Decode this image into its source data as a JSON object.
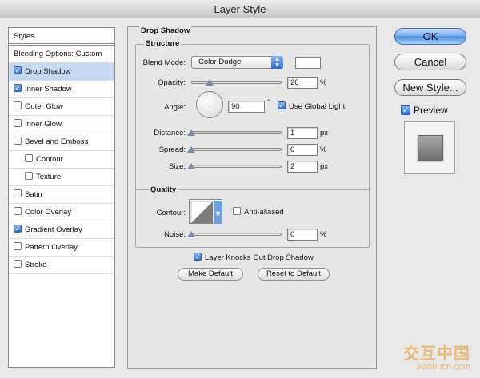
{
  "window": {
    "title": "Layer Style"
  },
  "sidebar": {
    "items": [
      {
        "label": "Styles",
        "checkbox": false,
        "checked": false,
        "indent": 0,
        "selected": false
      },
      {
        "label": "Blending Options: Custom",
        "checkbox": false,
        "checked": false,
        "indent": 0,
        "selected": false
      },
      {
        "label": "Drop Shadow",
        "checkbox": true,
        "checked": true,
        "indent": 0,
        "selected": true
      },
      {
        "label": "Inner Shadow",
        "checkbox": true,
        "checked": true,
        "indent": 0,
        "selected": false
      },
      {
        "label": "Outer Glow",
        "checkbox": true,
        "checked": false,
        "indent": 0,
        "selected": false
      },
      {
        "label": "Inner Glow",
        "checkbox": true,
        "checked": false,
        "indent": 0,
        "selected": false
      },
      {
        "label": "Bevel and Emboss",
        "checkbox": true,
        "checked": false,
        "indent": 0,
        "selected": false
      },
      {
        "label": "Contour",
        "checkbox": true,
        "checked": false,
        "indent": 1,
        "selected": false
      },
      {
        "label": "Texture",
        "checkbox": true,
        "checked": false,
        "indent": 1,
        "selected": false
      },
      {
        "label": "Satin",
        "checkbox": true,
        "checked": false,
        "indent": 0,
        "selected": false
      },
      {
        "label": "Color Overlay",
        "checkbox": true,
        "checked": false,
        "indent": 0,
        "selected": false
      },
      {
        "label": "Gradient Overlay",
        "checkbox": true,
        "checked": true,
        "indent": 0,
        "selected": false
      },
      {
        "label": "Pattern Overlay",
        "checkbox": true,
        "checked": false,
        "indent": 0,
        "selected": false
      },
      {
        "label": "Stroke",
        "checkbox": true,
        "checked": false,
        "indent": 0,
        "selected": false
      }
    ]
  },
  "drop_shadow": {
    "title": "Drop Shadow",
    "structure": {
      "title": "Structure",
      "blend_mode_label": "Blend Mode:",
      "blend_mode_value": "Color Dodge",
      "opacity_label": "Opacity:",
      "opacity_value": "20",
      "opacity_fraction": 0.2,
      "opacity_unit": "%",
      "angle_label": "Angle:",
      "angle_value": "90",
      "angle_unit": "°",
      "use_global_light_label": "Use Global Light",
      "use_global_light_checked": true,
      "distance_label": "Distance:",
      "distance_value": "1",
      "distance_fraction": 0.0,
      "distance_unit": "px",
      "spread_label": "Spread:",
      "spread_value": "0",
      "spread_fraction": 0.0,
      "spread_unit": "%",
      "size_label": "Size:",
      "size_value": "2",
      "size_fraction": 0.0,
      "size_unit": "px"
    },
    "quality": {
      "title": "Quality",
      "contour_label": "Contour:",
      "anti_aliased_label": "Anti-aliased",
      "anti_aliased_checked": false,
      "noise_label": "Noise:",
      "noise_value": "0",
      "noise_fraction": 0.0,
      "noise_unit": "%"
    },
    "knockout_label": "Layer Knocks Out Drop Shadow",
    "knockout_checked": true,
    "make_default_label": "Make Default",
    "reset_default_label": "Reset to Default"
  },
  "actions": {
    "ok_label": "OK",
    "cancel_label": "Cancel",
    "new_style_label": "New Style...",
    "preview_label": "Preview",
    "preview_checked": true
  },
  "watermark": {
    "top": "交互中国",
    "bottom": "Jiaohucn.com"
  },
  "colors": {
    "accent": "#3173d6",
    "selection": "#c6d9f3",
    "watermark": "#e9b66a"
  }
}
